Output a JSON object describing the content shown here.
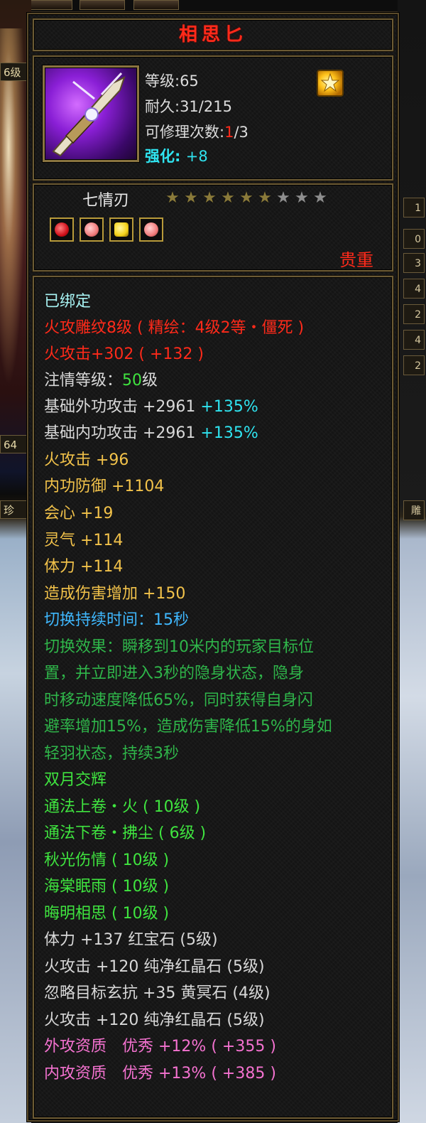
{
  "background": {
    "right_numbers": [
      "1",
      "0",
      "3",
      "4",
      "2",
      "4",
      "2"
    ],
    "left_labels": [
      "6级",
      "64",
      "珍"
    ],
    "right_labels": [
      "雕"
    ]
  },
  "item": {
    "name": "相思匕",
    "level_label": "等级:65",
    "durability_label": "耐久:31/215",
    "repair_prefix": "可修理次数:",
    "repair_used": "1",
    "repair_total": "/3",
    "enhance_label": "强化:",
    "enhance_value": "+8",
    "icon": "dagger-weapon-icon",
    "badge_icon": "gem-star-badge-icon",
    "series_name": "七情刃",
    "stars_lit": 6,
    "stars_total": 9,
    "sockets": [
      {
        "icon": "ruby-gem-icon",
        "color": "#e0101a"
      },
      {
        "icon": "pink-crystal-gem-icon",
        "color": "#f07a7a"
      },
      {
        "icon": "yellow-gem-icon",
        "color": "#f4d21a"
      },
      {
        "icon": "pink-crystal-gem-icon",
        "color": "#f07a7a"
      }
    ],
    "rarity": "贵重"
  },
  "attributes": {
    "bound": "已绑定",
    "engrave": "火攻雕纹8级 ( 精绘：4级2等・僵死 )",
    "fire_attack_main": "火攻击+302 ( +132 )",
    "infuse_prefix": "注情等级：",
    "infuse_level": "50",
    "infuse_suffix": "级",
    "base_external_label": "基础外功攻击 +2961",
    "base_external_pct": "+135%",
    "base_internal_label": "基础内功攻击 +2961",
    "base_internal_pct": "+135%",
    "stats": [
      "火攻击 +96",
      "内功防御 +1104",
      "会心 +19",
      "灵气 +114",
      "体力 +114",
      "造成伤害增加 +150"
    ],
    "switch_duration": "切换持续时间：15秒",
    "switch_effect": [
      "切换效果：瞬移到10米内的玩家目标位",
      "置，并立即进入3秒的隐身状态，隐身",
      "时移动速度降低65%，同时获得自身闪",
      "避率增加15%，造成伤害降低15%的身如",
      "轻羽状态，持续3秒"
    ],
    "set_skills": [
      "双月交辉",
      "通法上卷・火 ( 10级 )",
      "通法下卷・拂尘 ( 6级 )",
      "秋光伤情 ( 10级 )",
      "海棠眠雨 ( 10级 )",
      "晦明相思 ( 10级 )"
    ],
    "gems": [
      "体力 +137 红宝石 (5级)",
      "火攻击 +120 纯净红晶石 (5级)",
      "忽略目标玄抗 +35 黄冥石 (4级)",
      "火攻击 +120 纯净红晶石 (5级)"
    ],
    "aptitude": [
      "外攻资质　优秀 +12% ( +355 )",
      "内攻资质　优秀 +13% ( +385 )"
    ]
  }
}
